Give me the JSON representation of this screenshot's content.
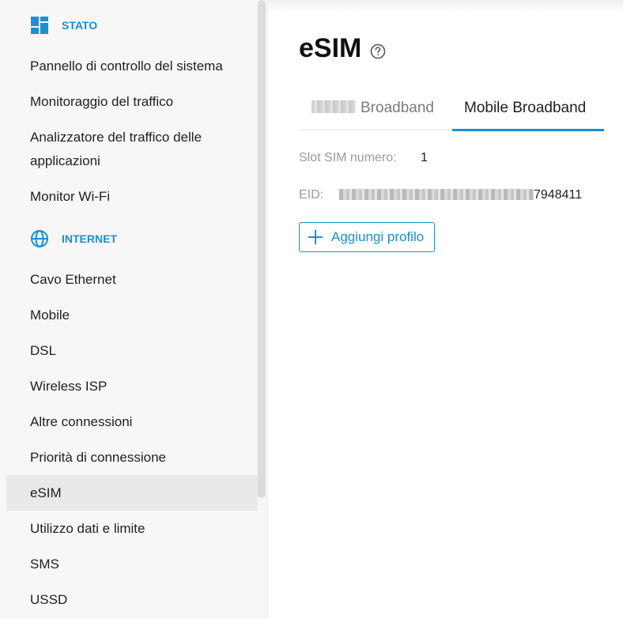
{
  "sidebar": {
    "status_header": "STATO",
    "status_items": [
      "Pannello di controllo del sistema",
      "Monitoraggio del traffico",
      "Analizzatore del traffico delle applicazioni",
      "Monitor Wi-Fi"
    ],
    "internet_header": "INTERNET",
    "internet_items": [
      "Cavo Ethernet",
      "Mobile",
      "DSL",
      "Wireless ISP",
      "Altre connessioni",
      "Priorità di connessione",
      "eSIM",
      "Utilizzo dati e limite",
      "SMS",
      "USSD"
    ],
    "active_item": "eSIM"
  },
  "main": {
    "title": "eSIM",
    "tabs": [
      {
        "label": "Broadband",
        "active": false
      },
      {
        "label": "Mobile Broadband",
        "active": true
      }
    ],
    "slot_label": "Slot SIM numero:",
    "slot_value": "1",
    "eid_label": "EID:",
    "eid_value_suffix": "7948411",
    "add_profile_label": "Aggiungi profilo"
  },
  "colors": {
    "accent": "#1a8fd6",
    "sidebar_bg": "#f7f7f7",
    "active_bg": "#e9e9e9"
  },
  "icons": {
    "status": "dashboard-icon",
    "internet": "globe-icon",
    "help": "help-circle-icon",
    "add": "plus-icon"
  }
}
